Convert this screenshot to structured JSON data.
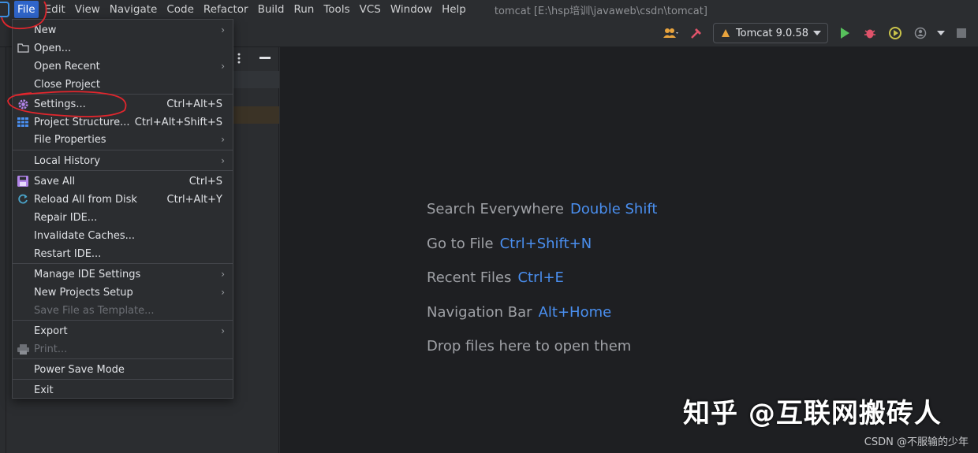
{
  "menubar": {
    "items": [
      "File",
      "Edit",
      "View",
      "Navigate",
      "Code",
      "Refactor",
      "Build",
      "Run",
      "Tools",
      "VCS",
      "Window",
      "Help"
    ],
    "window_title": "tomcat [E:\\hsp培训\\javaweb\\csdn\\tomcat]"
  },
  "toolbar": {
    "run_config": "Tomcat 9.0.58",
    "icons": [
      "users-icon",
      "hammer-icon",
      "tomcat-icon",
      "run-icon",
      "debug-icon",
      "coverage-icon",
      "profile-icon",
      "stop-icon"
    ]
  },
  "file_menu": {
    "new": "New",
    "open": "Open...",
    "open_recent": "Open Recent",
    "close_project": "Close Project",
    "settings": "Settings...",
    "settings_sc": "Ctrl+Alt+S",
    "project_structure": "Project Structure...",
    "project_structure_sc": "Ctrl+Alt+Shift+S",
    "file_properties": "File Properties",
    "local_history": "Local History",
    "save_all": "Save All",
    "save_all_sc": "Ctrl+S",
    "reload": "Reload All from Disk",
    "reload_sc": "Ctrl+Alt+Y",
    "repair": "Repair IDE...",
    "invalidate": "Invalidate Caches...",
    "restart": "Restart IDE...",
    "manage_settings": "Manage IDE Settings",
    "new_projects_setup": "New Projects Setup",
    "save_template": "Save File as Template...",
    "export": "Export",
    "print": "Print...",
    "power_save": "Power Save Mode",
    "exit": "Exit"
  },
  "editor_hints": [
    {
      "label": "Search Everywhere",
      "key": "Double Shift"
    },
    {
      "label": "Go to File",
      "key": "Ctrl+Shift+N"
    },
    {
      "label": "Recent Files",
      "key": "Ctrl+E"
    },
    {
      "label": "Navigation Bar",
      "key": "Alt+Home"
    },
    {
      "label": "Drop files here to open them",
      "key": ""
    }
  ],
  "watermark": {
    "main": "知乎 @互联网搬砖人",
    "sub": "CSDN @不服输的少年"
  },
  "colors": {
    "accent": "#2f65ca",
    "hint_key": "#4a8ff0",
    "annotation": "#e0262d"
  }
}
